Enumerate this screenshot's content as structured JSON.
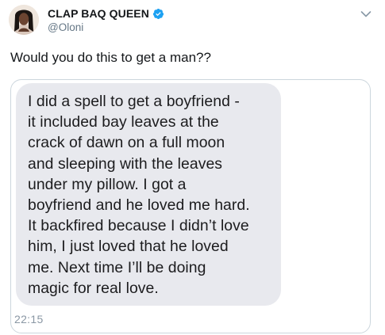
{
  "tweet": {
    "display_name": "CLAP BAQ QUEEN",
    "handle": "@Oloni",
    "text": "Would you do this to get a man??"
  },
  "media": {
    "message_text": "I did a spell to get a boyfriend -\nit included bay leaves at the\ncrack of dawn on a full moon\nand sleeping with the leaves\nunder my pillow. I got a\nboyfriend and he loved me hard.\nIt backfired because I didn’t love\nhim, I just loved that he loved\nme. Next time I’ll be doing\nmagic for real love.",
    "time": "22:15"
  },
  "icons": {
    "verified": "verified-badge-icon",
    "menu": "chevron-down-icon",
    "avatar": "avatar"
  },
  "colors": {
    "verified_blue": "#1da1f2",
    "bubble_gray": "#e8e9ee",
    "secondary_text": "#657786",
    "card_border": "#ccd6dd"
  }
}
